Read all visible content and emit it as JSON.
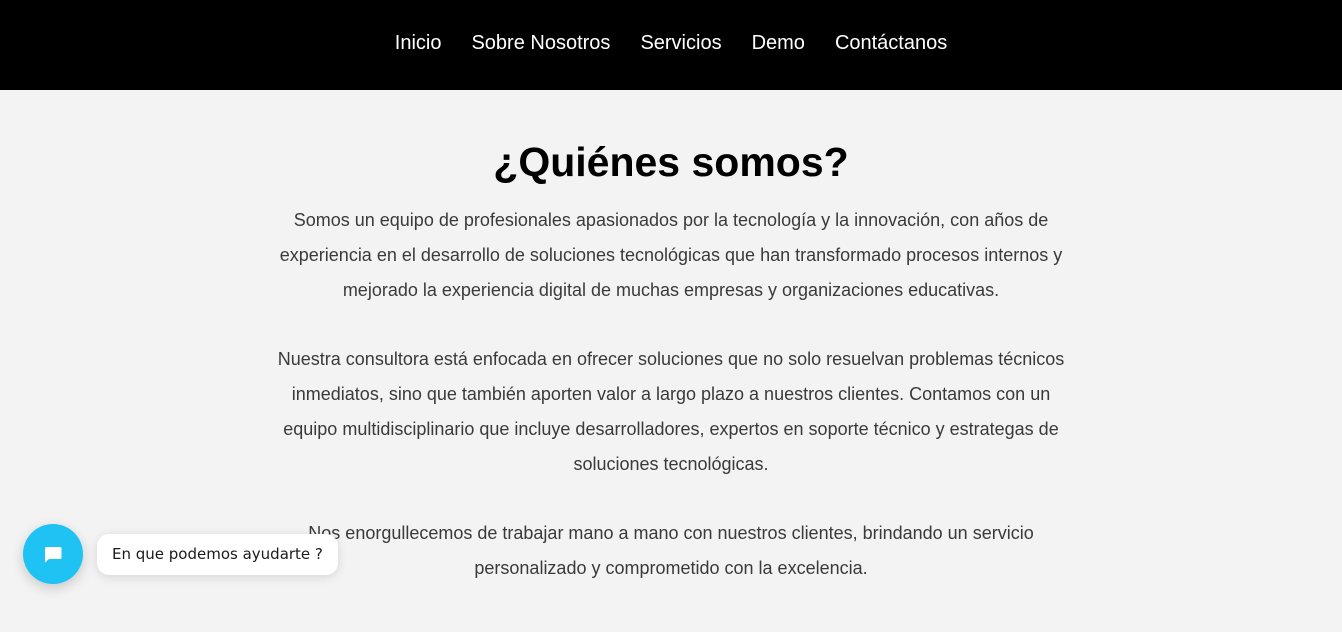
{
  "nav": {
    "items": [
      {
        "label": "Inicio"
      },
      {
        "label": "Sobre Nosotros"
      },
      {
        "label": "Servicios"
      },
      {
        "label": "Demo"
      },
      {
        "label": "Contáctanos"
      }
    ]
  },
  "about": {
    "title": "¿Quiénes somos?",
    "paragraphs": [
      "Somos un equipo de profesionales apasionados por la tecnología y la innovación, con años de experiencia en el desarrollo de soluciones tecnológicas que han transformado procesos internos y mejorado la experiencia digital de muchas empresas y organizaciones educativas.",
      "Nuestra consultora está enfocada en ofrecer soluciones que no solo resuelvan problemas técnicos inmediatos, sino que también aporten valor a largo plazo a nuestros clientes. Contamos con un equipo multidisciplinario que incluye desarrolladores, expertos en soporte técnico y estrategas de soluciones tecnológicas.",
      "Nos enorgullecemos de trabajar mano a mano con nuestros clientes, brindando un servicio personalizado y comprometido con la excelencia."
    ]
  },
  "chat": {
    "icon": "chat-icon",
    "prompt": "En que podemos ayudarte ?",
    "accent_color": "#1ec3f3"
  }
}
